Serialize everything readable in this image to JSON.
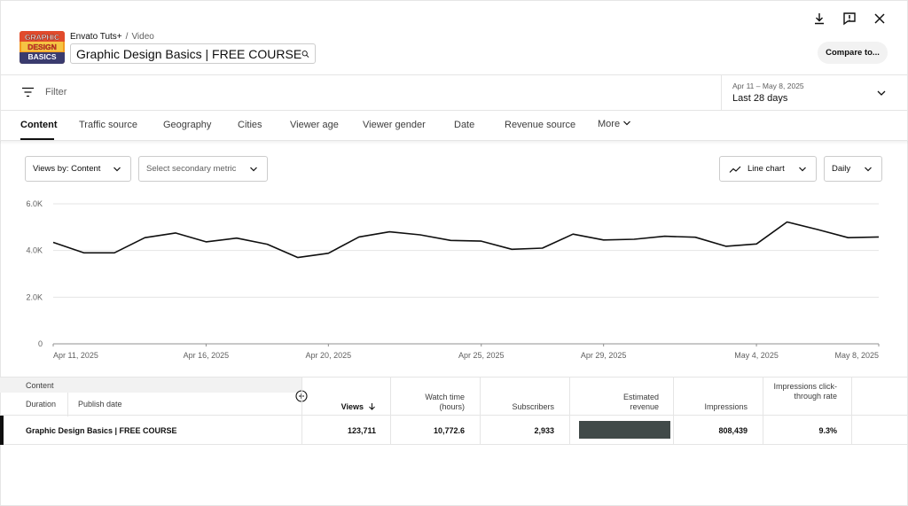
{
  "header": {
    "channel": "Envato Tuts+",
    "section": "Video",
    "video_title": "Graphic Design Basics | FREE COURSE",
    "thumbnail_text": [
      "GRAPHIC",
      "DESIGN",
      "BASICS"
    ],
    "compare_label": "Compare to..."
  },
  "toolbar_icons": [
    "download-icon",
    "feedback-icon",
    "close-icon"
  ],
  "filter": {
    "placeholder": "Filter",
    "date_range": "Apr 11 – May 8, 2025",
    "period_label": "Last 28 days"
  },
  "tabs": [
    "Content",
    "Traffic source",
    "Geography",
    "Cities",
    "Viewer age",
    "Viewer gender",
    "Date",
    "Revenue source",
    "More"
  ],
  "controls": {
    "primary_metric": "Views by: Content",
    "secondary_metric": "Select secondary metric",
    "chart_type": "Line chart",
    "granularity": "Daily"
  },
  "chart_data": {
    "type": "line",
    "x": [
      "Apr 11, 2025",
      "Apr 12",
      "Apr 13",
      "Apr 14",
      "Apr 15",
      "Apr 16, 2025",
      "Apr 17",
      "Apr 18",
      "Apr 19",
      "Apr 20, 2025",
      "Apr 21",
      "Apr 22",
      "Apr 23",
      "Apr 24",
      "Apr 25, 2025",
      "Apr 26",
      "Apr 27",
      "Apr 28",
      "Apr 29, 2025",
      "Apr 30",
      "May 1",
      "May 2",
      "May 3",
      "May 4, 2025",
      "May 5",
      "May 6",
      "May 7",
      "May 8, 2025"
    ],
    "series": [
      {
        "name": "",
        "values": [
          4350,
          3900,
          3900,
          4550,
          4750,
          4370,
          4530,
          4270,
          3700,
          3880,
          4580,
          4800,
          4670,
          4430,
          4400,
          4050,
          4100,
          4700,
          4450,
          4480,
          4610,
          4570,
          4180,
          4280,
          5220,
          4900,
          4550,
          4580
        ]
      }
    ],
    "x_tick_labels": [
      "Apr 11, 2025",
      "Apr 16, 2025",
      "Apr 20, 2025",
      "Apr 25, 2025",
      "Apr 29, 2025",
      "May 4, 2025",
      "May 8, 2025"
    ],
    "y_tick_labels": [
      "0",
      "2.0K",
      "4.0K",
      "6.0K"
    ],
    "ylim": [
      0,
      6000
    ],
    "grid": true,
    "color": "#0f0f0f"
  },
  "table": {
    "dimension_header": "Content",
    "sub_headers": [
      "Duration",
      "Publish date"
    ],
    "metric_headers": [
      "Views",
      "Watch time (hours)",
      "Subscribers",
      "Estimated revenue",
      "Impressions",
      "Impressions click-through rate"
    ],
    "rows": [
      {
        "title": "Graphic Design Basics | FREE COURSE",
        "views": "123,711",
        "watch_time": "10,772.6",
        "subscribers": "2,933",
        "impressions": "808,439",
        "ctr": "9.3%"
      }
    ]
  }
}
